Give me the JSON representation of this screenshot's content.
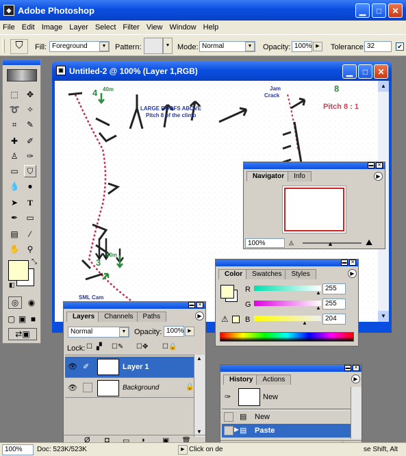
{
  "app": {
    "title": "Adobe Photoshop"
  },
  "menu": [
    "File",
    "Edit",
    "Image",
    "Layer",
    "Select",
    "Filter",
    "View",
    "Window",
    "Help"
  ],
  "options": {
    "fill_label": "Fill:",
    "fill_value": "Foreground",
    "pattern_label": "Pattern:",
    "mode_label": "Mode:",
    "mode_value": "Normal",
    "opacity_label": "Opacity:",
    "opacity_value": "100%",
    "tolerance_label": "Tolerance:",
    "tolerance_value": "32"
  },
  "document": {
    "title": "Untitled-2 @ 100% (Layer 1,RGB)",
    "annotations": {
      "roofs": "LARGE ROOFS ABOVE",
      "pitch_line": "Pitch 8 of the climb",
      "jam": "Jam",
      "crack": "Crack",
      "pitch_label": "Pitch 8 : 1",
      "num8": "8",
      "num4": "4",
      "d40": "40m",
      "num3": "3",
      "d30": "30m",
      "sml": "SML Cam"
    }
  },
  "navigator": {
    "tabs": [
      "Navigator",
      "Info"
    ],
    "zoom": "100%"
  },
  "color": {
    "tabs": [
      "Color",
      "Swatches",
      "Styles"
    ],
    "channels": [
      {
        "label": "R",
        "value": "255"
      },
      {
        "label": "G",
        "value": "255"
      },
      {
        "label": "B",
        "value": "204"
      }
    ]
  },
  "layers": {
    "tabs": [
      "Layers",
      "Channels",
      "Paths"
    ],
    "blend": "Normal",
    "opacity_label": "Opacity:",
    "opacity_value": "100%",
    "lock_label": "Lock:",
    "items": [
      {
        "name": "Layer 1"
      },
      {
        "name": "Background"
      }
    ]
  },
  "history": {
    "tabs": [
      "History",
      "Actions"
    ],
    "snapshot": "New",
    "items": [
      {
        "name": "New"
      },
      {
        "name": "Paste"
      }
    ]
  },
  "status": {
    "zoom": "100%",
    "doc": "Doc: 523K/523K",
    "hint_a": "Click on de",
    "hint_b": "se Shift, Alt"
  },
  "colors": {
    "accent": "#316ac5",
    "foreground": "#ffffcc",
    "route": "#c0304a",
    "green_note": "#2e8b3e",
    "blue_note": "#2a3a9a",
    "red_note": "#d04050"
  }
}
